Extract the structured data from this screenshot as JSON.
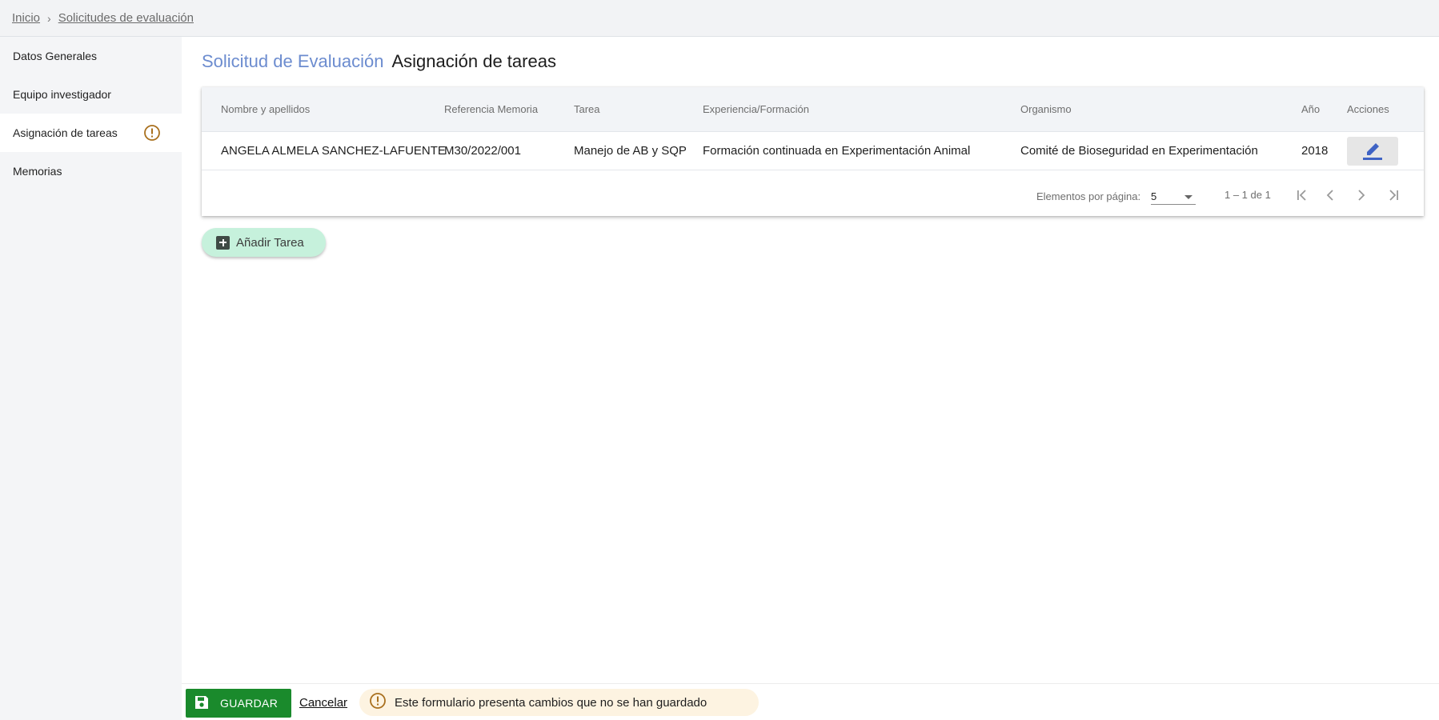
{
  "breadcrumb": {
    "items": [
      "Inicio",
      "Solicitudes de evaluación"
    ]
  },
  "sidebar": {
    "items": [
      {
        "label": "Datos Generales"
      },
      {
        "label": "Equipo investigador"
      },
      {
        "label": "Asignación de tareas",
        "active": true,
        "icon": "warning-icon"
      },
      {
        "label": "Memorias"
      }
    ]
  },
  "header": {
    "title_prefix": "Solicitud de Evaluación",
    "title": "Asignación de tareas"
  },
  "table": {
    "columns": [
      "Nombre y apellidos",
      "Referencia Memoria",
      "Tarea",
      "Experiencia/Formación",
      "Organismo",
      "Año",
      "Acciones"
    ],
    "rows": [
      {
        "nombre": "ANGELA ALMELA SANCHEZ-LAFUENTE",
        "referencia": "M30/2022/001",
        "tarea": "Manejo de AB y SQP",
        "experiencia": "Formación continuada en Experimentación Animal",
        "organismo": "Comité de Bioseguridad en Experimentación",
        "anio": "2018",
        "action_icon": "edit-icon"
      }
    ]
  },
  "paginator": {
    "label": "Elementos por página:",
    "page_size": "5",
    "range": "1 – 1 de 1"
  },
  "actions": {
    "add_label": "Añadir Tarea",
    "save_label": "GUARDAR",
    "cancel_label": "Cancelar",
    "unsaved_message": "Este formulario presenta cambios que no se han guardado"
  },
  "colors": {
    "accent_title": "#6c8ccf",
    "save_button": "#1a8a2c",
    "add_button": "#c6f1dc",
    "warning": "#a9701e",
    "edit_icon": "#3f63c4"
  }
}
